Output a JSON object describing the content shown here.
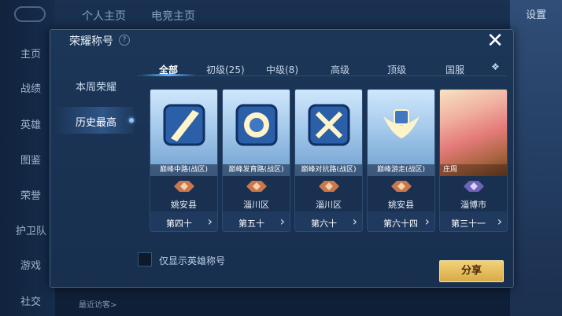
{
  "background": {
    "top_tabs": [
      "个人主页",
      "电竞主页"
    ],
    "nav": [
      "主页",
      "战绩",
      "英雄",
      "图鉴",
      "荣誉",
      "护卫队",
      "游戏",
      "社交"
    ],
    "settings": "设置",
    "visitor_label": "最近访客>"
  },
  "dialog": {
    "title": "荣耀称号",
    "help": "?",
    "close": "✕",
    "side_tabs": [
      {
        "label": "本周荣耀",
        "active": false
      },
      {
        "label": "历史最高",
        "active": true
      }
    ],
    "tabs": [
      {
        "label": "全部",
        "active": true
      },
      {
        "label": "初级(25)",
        "active": false
      },
      {
        "label": "中级(8)",
        "active": false
      },
      {
        "label": "高级",
        "active": false
      },
      {
        "label": "顶级",
        "active": false
      },
      {
        "label": "国服",
        "active": false
      }
    ],
    "cards": [
      {
        "name": "巅峰中路(战区)",
        "region": "姚安县",
        "rank": "第四十",
        "emblem": "slash-emblem-icon"
      },
      {
        "name": "巅峰发育路(战区)",
        "region": "淄川区",
        "rank": "第五十",
        "emblem": "coin-emblem-icon"
      },
      {
        "name": "巅峰对抗路(战区)",
        "region": "淄川区",
        "rank": "第六十",
        "emblem": "swords-emblem-icon"
      },
      {
        "name": "巅峰游走(战区)",
        "region": "姚安县",
        "rank": "第六十四",
        "emblem": "wings-emblem-icon"
      },
      {
        "name": "庄周",
        "region": "淄博市",
        "rank": "第三十一",
        "emblem": "hero-portrait"
      }
    ],
    "checkbox_label": "仅显示英雄称号",
    "share_label": "分享"
  },
  "colors": {
    "accent": "#5fb3ff",
    "share_button": "#e8c062"
  }
}
